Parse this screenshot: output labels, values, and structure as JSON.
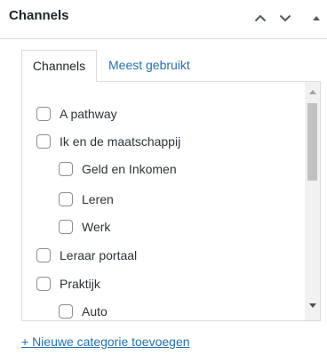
{
  "panel": {
    "title": "Channels",
    "move_up_icon": "chevron-up-icon",
    "move_down_icon": "chevron-down-icon",
    "toggle_icon": "caret-up-icon"
  },
  "tabs": [
    {
      "label": "Channels",
      "active": true
    },
    {
      "label": "Meest gebruikt",
      "active": false
    }
  ],
  "categories": [
    {
      "label": "A pathway",
      "level": 0,
      "checked": false
    },
    {
      "label": "Ik en de maatschappij",
      "level": 0,
      "checked": false
    },
    {
      "label": "Geld en Inkomen",
      "level": 1,
      "checked": false
    },
    {
      "label": "Leren",
      "level": 1,
      "checked": false
    },
    {
      "label": "Werk",
      "level": 1,
      "checked": false
    },
    {
      "label": "Leraar portaal",
      "level": 0,
      "checked": false
    },
    {
      "label": "Praktijk",
      "level": 0,
      "checked": false
    },
    {
      "label": "Auto",
      "level": 1,
      "checked": false
    }
  ],
  "add_category_link": "+ Nieuwe categorie toevoegen",
  "colors": {
    "link": "#2271b1",
    "border": "#dcdcde",
    "checkbox_border": "#8c8f94",
    "header_icons": "#50575e"
  }
}
